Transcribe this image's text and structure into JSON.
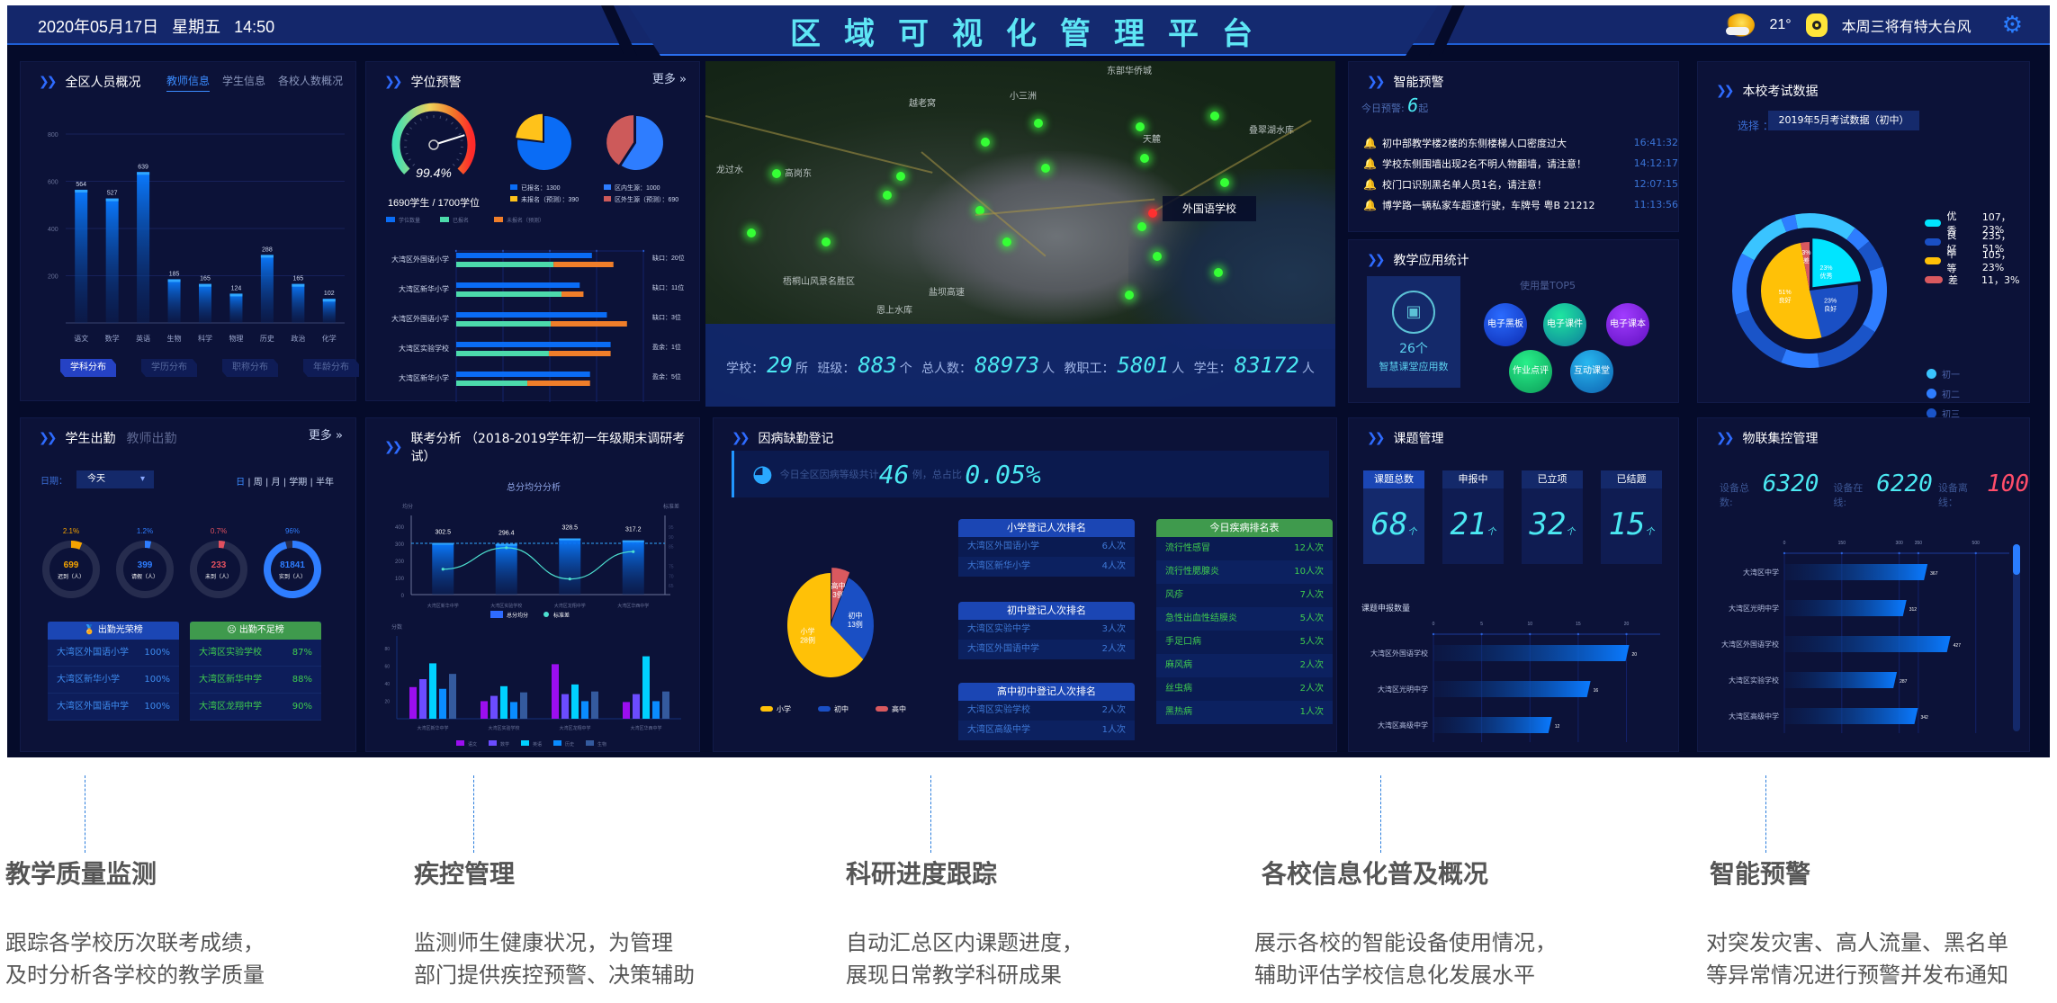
{
  "header": {
    "datetime": "2020年05月17日  星期五  14:50",
    "title": "区域可视化管理平台",
    "temperature": "21°",
    "weather_icon": "partly-sunny-icon",
    "notice": "本周三将有特大台风",
    "settings_icon": "gear-icon"
  },
  "staff_overview": {
    "title": "全区人员概况",
    "tabs": [
      "教师信息",
      "学生信息",
      "各校人数概况"
    ],
    "active_tab": 0,
    "sub_buttons": [
      "学科分布",
      "学历分布",
      "职称分布",
      "年龄分布"
    ],
    "active_sub": 0
  },
  "seat_warning": {
    "title": "学位预警",
    "more": "更多 »",
    "gauge_value": "99.4%",
    "gauge_fraction": 0.994,
    "gauge_caption": "1690学生 / 1700学位",
    "pie1_legend": [
      "已报名：1300",
      "未报名（预测）：390"
    ],
    "pie2_legend": [
      "区内生源：1000",
      "区外生源（预测）：690"
    ],
    "bar_legend": [
      "学位数量",
      "已报名",
      "未报名（预测）"
    ]
  },
  "map": {
    "tooltip": "外国语学校",
    "labels": [
      "龙过水",
      "高岗东",
      "越老窝",
      "东部华侨城",
      "小三洲",
      "天麓",
      "叠翠湖水库",
      "恩上水库",
      "梧桐山风景名胜区",
      "盐坝高速"
    ],
    "stats": [
      {
        "label": "学校：",
        "value": "29",
        "unit": "所"
      },
      {
        "label": "班级：",
        "value": "883",
        "unit": "个"
      },
      {
        "label": "总人数：",
        "value": "88973",
        "unit": "人"
      },
      {
        "label": "教职工：",
        "value": "5801",
        "unit": "人"
      },
      {
        "label": "学生：",
        "value": "83172",
        "unit": "人"
      }
    ]
  },
  "smart_warning": {
    "title": "智能预警",
    "today_label": "今日预警:",
    "today_count": "6",
    "today_unit": "起",
    "items": [
      {
        "msg": "初中部教学楼2楼的东侧楼梯人口密度过大",
        "time": "16:41:32"
      },
      {
        "msg": "学校东侧围墙出现2名不明人物翻墙，请注意！",
        "time": "14:12:17"
      },
      {
        "msg": "校门口识别黑名单人员1名，请注意！",
        "time": "12:07:15"
      },
      {
        "msg": "博学路一辆私家车超速行驶，车牌号 粤B 21212",
        "time": "11:13:56"
      }
    ]
  },
  "teaching_apps": {
    "title": "教学应用统计",
    "count": "26个",
    "count_label": "智慧课堂应用数",
    "top5_label": "使用量TOP5",
    "bubbles": [
      "电子黑板",
      "电子课件",
      "电子课本",
      "作业点评",
      "互动课堂"
    ]
  },
  "exam_data": {
    "title": "本校考试数据",
    "select_label": "选择 ：",
    "select_value": "2019年5月考试数据（初中）",
    "legend": [
      {
        "name": "优秀",
        "value": "107，23%",
        "color": "#00e5ff"
      },
      {
        "name": "良好",
        "value": "235，51%",
        "color": "#1a4fc4"
      },
      {
        "name": "中等",
        "value": "105，23%",
        "color": "#ffc107"
      },
      {
        "name": "差",
        "value": "11，3%",
        "color": "#d9595f"
      }
    ],
    "grades": [
      "初一",
      "初二",
      "初三"
    ]
  },
  "attendance": {
    "tabs": [
      "学生出勤",
      "教师出勤"
    ],
    "more": "更多 »",
    "date_label": "日期：",
    "date_value": "今天",
    "periods": [
      "日",
      "周",
      "月",
      "学期",
      "半年"
    ],
    "rings": [
      {
        "pct": "2.1%",
        "frac": 0.021,
        "value": "699",
        "label": "迟到（人）",
        "color": "#f5a300"
      },
      {
        "pct": "1.2%",
        "frac": 0.012,
        "value": "399",
        "label": "请假（人）",
        "color": "#2e7dff"
      },
      {
        "pct": "0.7%",
        "frac": 0.007,
        "value": "233",
        "label": "未到（人）",
        "color": "#e0505f"
      },
      {
        "pct": "96%",
        "frac": 0.96,
        "value": "81841",
        "label": "实到（人）",
        "color": "#2e7dff"
      }
    ],
    "honor_title": "出勤光荣榜",
    "honor": [
      [
        "大湾区外国语小学",
        "100%"
      ],
      [
        "大湾区新华小学",
        "100%"
      ],
      [
        "大湾区外国语中学",
        "100%"
      ]
    ],
    "low_title": "出勤不足榜",
    "low": [
      [
        "大湾区实验学校",
        "87%"
      ],
      [
        "大湾区新华中学",
        "88%"
      ],
      [
        "大湾区龙翔中学",
        "90%"
      ]
    ]
  },
  "joint_exam": {
    "title": "联考分析 （2018-2019学年初一年级期末调研考试）"
  },
  "sick_leave": {
    "title": "因病缺勤登记",
    "summary_pre": "今日全区因病等级共计",
    "count": "46",
    "count_unit": "例，总占比",
    "ratio": "0.05%",
    "pie_legend": [
      "小学",
      "初中",
      "高中"
    ],
    "primary_title": "小学登记人次排名",
    "primary": [
      [
        "大湾区外国语小学",
        "6人次"
      ],
      [
        "大湾区新华小学",
        "4人次"
      ]
    ],
    "middle_title": "初中登记人次排名",
    "middle": [
      [
        "大湾区实验中学",
        "3人次"
      ],
      [
        "大湾区外国语中学",
        "2人次"
      ]
    ],
    "high_title": "高中初中登记人次排名",
    "high": [
      [
        "大湾区实验学校",
        "2人次"
      ],
      [
        "大湾区高级中学",
        "1人次"
      ]
    ],
    "disease_title": "今日疾病排名表",
    "diseases": [
      [
        "流行性感冒",
        "12人次"
      ],
      [
        "流行性腮腺炎",
        "10人次"
      ],
      [
        "风疹",
        "7人次"
      ],
      [
        "急性出血性结膜炎",
        "5人次"
      ],
      [
        "手足口病",
        "5人次"
      ],
      [
        "麻风病",
        "2人次"
      ],
      [
        "丝虫病",
        "2人次"
      ],
      [
        "黑热病",
        "1人次"
      ]
    ]
  },
  "projects": {
    "title": "课题管理",
    "cards": [
      {
        "label": "课题总数",
        "value": "68",
        "unit": "个"
      },
      {
        "label": "申报中",
        "value": "21",
        "unit": "个"
      },
      {
        "label": "已立项",
        "value": "32",
        "unit": "个"
      },
      {
        "label": "已结题",
        "value": "15",
        "unit": "个"
      }
    ]
  },
  "iot": {
    "title": "物联集控管理",
    "total_label": "设备总数:",
    "total": "6320",
    "online_label": "设备在线:",
    "online": "6220",
    "offline_label": "设备离线：",
    "offline": "100"
  },
  "captions": [
    {
      "title": "教学质量监测",
      "desc": [
        "跟踪各学校历次联考成绩，",
        "及时分析各学校的教学质量"
      ]
    },
    {
      "title": "疾控管理",
      "desc": [
        "监测师生健康状况，为管理",
        "部门提供疾控预警、决策辅助"
      ]
    },
    {
      "title": "科研进度跟踪",
      "desc": [
        "自动汇总区内课题进度，",
        "展现日常教学科研成果"
      ]
    },
    {
      "title": "各校信息化普及概况",
      "desc": [
        "展示各校的智能设备使用情况，",
        "辅助评估学校信息化发展水平"
      ]
    },
    {
      "title": "智能预警",
      "desc": [
        "对突发灾害、高人流量、黑名单",
        "等异常情况进行预警并发布通知"
      ]
    }
  ],
  "chart_data": [
    {
      "id": "teacher_subject",
      "type": "bar",
      "title": "",
      "categories": [
        "语文",
        "数学",
        "英语",
        "生物",
        "科学",
        "物理",
        "历史",
        "政治",
        "化学"
      ],
      "values": [
        564,
        527,
        639,
        185,
        165,
        124,
        288,
        165,
        102
      ],
      "ylim": [
        0,
        800
      ],
      "yticks": [
        200,
        400,
        600,
        800
      ],
      "grid": true
    },
    {
      "id": "enrolled_pie",
      "type": "pie",
      "labels": [
        "已报名",
        "未报名（预测）"
      ],
      "values": [
        1300,
        390
      ],
      "colors": [
        "#0a6cf5",
        "#ffc21a"
      ]
    },
    {
      "id": "source_pie",
      "type": "pie",
      "labels": [
        "区内生源",
        "区外生源（预测）"
      ],
      "values": [
        1000,
        690
      ],
      "colors": [
        "#2e7dff",
        "#cd5a5a"
      ]
    },
    {
      "id": "seat_bars",
      "type": "bar",
      "orientation": "horizontal",
      "categories": [
        "大湾区外国语小学",
        "大湾区新华小学",
        "大湾区外国语小学",
        "大湾区实验学校",
        "大湾区新华小学"
      ],
      "series": [
        {
          "name": "学位数量",
          "values": [
            290,
            264,
            322,
            330,
            286
          ],
          "color": "#0a6cf5"
        },
        {
          "name": "已报名",
          "values": [
            208,
            225,
            202,
            198,
            152
          ],
          "color": "#4cdaab"
        },
        {
          "name": "未报名（预测）",
          "values": [
            128,
            47,
            163,
            132,
            134
          ],
          "color": "#f07e2a"
        }
      ],
      "annotations": [
        "缺口：20位",
        "缺口：11位",
        "缺口：3位",
        "盈余：1位",
        "盈余：5位"
      ],
      "xlim": [
        0,
        400
      ]
    },
    {
      "id": "avg_score",
      "type": "bar",
      "title": "总分均分分析",
      "categories": [
        "大湾区新华中学",
        "大湾区实验学校",
        "大湾区龙翔中学",
        "大湾区华西中学"
      ],
      "series": [
        {
          "name": "总分均分",
          "values": [
            302.5,
            296.4,
            328.5,
            317.2
          ],
          "axis": "left"
        },
        {
          "name": "标准差",
          "type": "line",
          "values": [
            73,
            84,
            68,
            82
          ],
          "axis": "right"
        }
      ],
      "ylabel": "均分",
      "ylabel_right": "标准差",
      "ylim": [
        0,
        400
      ],
      "yticks": [
        0,
        100,
        200,
        300,
        400
      ],
      "ylim_right": [
        65,
        95
      ],
      "yticks_right": [
        65,
        70,
        75,
        85,
        90,
        95
      ],
      "reference_line": 300
    },
    {
      "id": "subject_scores",
      "type": "bar",
      "categories": [
        "大湾区新华中学",
        "大湾区实验学校",
        "大湾区龙翔中学",
        "大湾区华西中学"
      ],
      "series": [
        {
          "name": "语文",
          "values": [
            36,
            20,
            62,
            19
          ],
          "color": "#9b0ef0"
        },
        {
          "name": "数学",
          "values": [
            45,
            26,
            28,
            28
          ],
          "color": "#6b4cff"
        },
        {
          "name": "英语",
          "values": [
            63,
            37,
            39,
            71
          ],
          "color": "#00d1ff"
        },
        {
          "name": "历史",
          "values": [
            34,
            19,
            20,
            20
          ],
          "color": "#0a8cff"
        },
        {
          "name": "生物",
          "values": [
            51,
            30,
            31,
            31
          ],
          "color": "#345a9e"
        }
      ],
      "ylabel": "分数",
      "ylim": [
        0,
        90
      ],
      "yticks": [
        20,
        40,
        60,
        80
      ]
    },
    {
      "id": "sick_pie",
      "type": "pie",
      "labels": [
        "小学",
        "初中",
        "高中"
      ],
      "values": [
        28,
        13,
        3
      ],
      "data_labels": [
        "小学 28例",
        "初中 13例",
        "高中 3例"
      ],
      "colors": [
        "#ffc107",
        "#1a4fc4",
        "#d9595f"
      ]
    },
    {
      "id": "exam_pie",
      "type": "pie",
      "labels": [
        "优秀",
        "良好",
        "中等",
        "差"
      ],
      "values": [
        23,
        23,
        51,
        3
      ],
      "data_labels": [
        "23% 优秀",
        "23% 良好",
        "51% 良好",
        "3% 差"
      ],
      "colors": [
        "#00e5ff",
        "#1a4fc4",
        "#ffc107",
        "#d9595f"
      ]
    },
    {
      "id": "project_bars",
      "type": "bar",
      "orientation": "horizontal",
      "title": "课题申报数量",
      "categories": [
        "大湾区外国语学校",
        "大湾区光明中学",
        "大湾区高级中学"
      ],
      "values": [
        20,
        16,
        12
      ],
      "xlim": [
        0,
        22
      ],
      "xticks": [
        0,
        5,
        10,
        15,
        20
      ]
    },
    {
      "id": "iot_bars",
      "type": "bar",
      "orientation": "horizontal",
      "categories": [
        "大湾区中学",
        "大湾区光明中学",
        "大湾区外国语学校",
        "大湾区实验学校",
        "大湾区高级中学"
      ],
      "values": [
        367,
        312,
        427,
        287,
        342
      ],
      "xlim": [
        0,
        550
      ],
      "xticks": [
        0,
        150,
        300,
        350,
        500
      ]
    }
  ]
}
